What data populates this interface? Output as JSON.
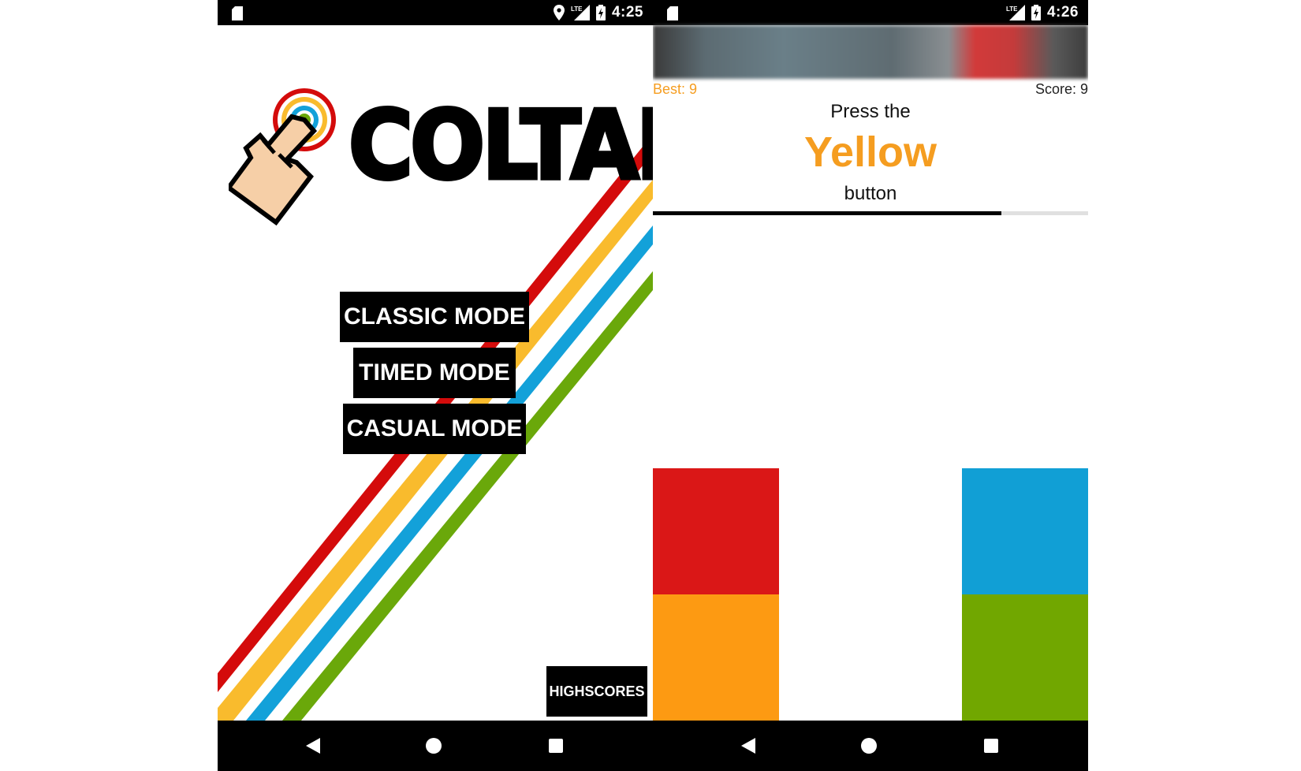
{
  "left_screen": {
    "status_bar": {
      "time": "4:25",
      "network": "LTE"
    },
    "app_title": "COLTAP",
    "modes": {
      "classic": "CLASSIC MODE",
      "timed": "TIMED MODE",
      "casual": "CASUAL MODE"
    },
    "highscores_label": "HIGHSCORES",
    "stripe_colors": [
      "#d40b0b",
      "#f9bb2d",
      "#13a1d9",
      "#6aa80a"
    ]
  },
  "right_screen": {
    "status_bar": {
      "time": "4:26",
      "network": "LTE"
    },
    "best_label": "Best: 9",
    "score_label": "Score: 9",
    "prompt_top": "Press the",
    "target_color": "Yellow",
    "target_color_hex": "#f59d20",
    "prompt_bottom": "button",
    "timer_progress": 0.8,
    "tiles": [
      {
        "name": "red",
        "color": "#da1717"
      },
      {
        "name": "orange",
        "color": "#fd9a12"
      },
      {
        "name": "blue",
        "color": "#119fd5"
      },
      {
        "name": "green",
        "color": "#71a700"
      }
    ]
  },
  "nav_icons": [
    "back-icon",
    "home-icon",
    "recents-icon"
  ]
}
